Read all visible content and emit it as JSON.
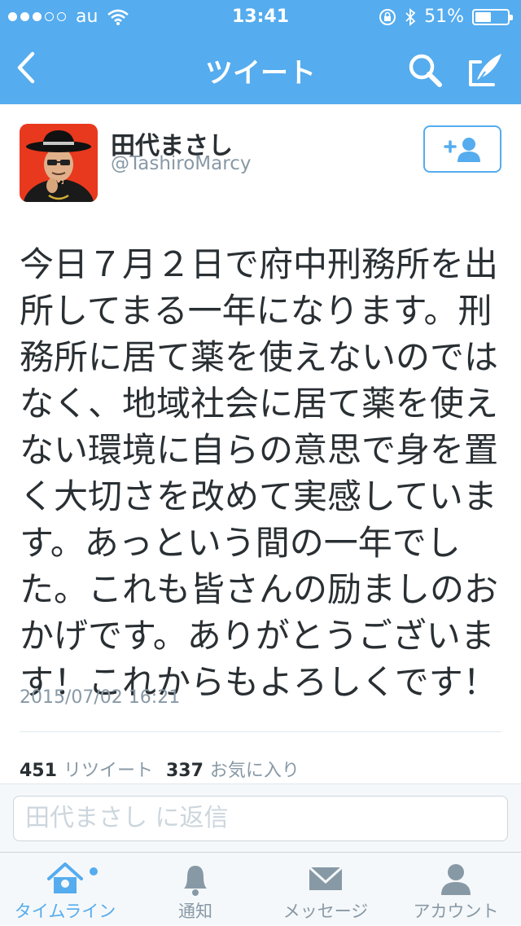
{
  "status_bar": {
    "carrier": "au",
    "time": "13:41",
    "battery": "51%",
    "battery_level": 0.51,
    "signal_bars": 3
  },
  "nav": {
    "title": "ツイート"
  },
  "profile": {
    "name": "田代まさし",
    "handle": "@TashiroMarcy"
  },
  "tweet": {
    "text": "今日７月２日で府中刑務所を出所してまる一年になります。刑務所に居て薬を使えないのではなく、地域社会に居て薬を使えない環境に自らの意思で身を置く大切さを改めて実感しています。あっという間の一年でした。これも皆さんの励ましのおかげです。ありがとうございます！これからもよろしくです！",
    "date": "2015/07/02 16:21",
    "retweet_count": "451",
    "retweet_label": "リツイート",
    "favorite_count": "337",
    "favorite_label": "お気に入り"
  },
  "reply": {
    "placeholder": "田代まさし に返信"
  },
  "tabs": [
    {
      "label": "タイムライン",
      "icon": "home-icon",
      "active": true
    },
    {
      "label": "通知",
      "icon": "bell-icon",
      "active": false
    },
    {
      "label": "メッセージ",
      "icon": "envelope-icon",
      "active": false
    },
    {
      "label": "アカウント",
      "icon": "person-icon",
      "active": false
    }
  ],
  "colors": {
    "accent": "#55acee",
    "text": "#292f33",
    "muted": "#8899a6"
  }
}
